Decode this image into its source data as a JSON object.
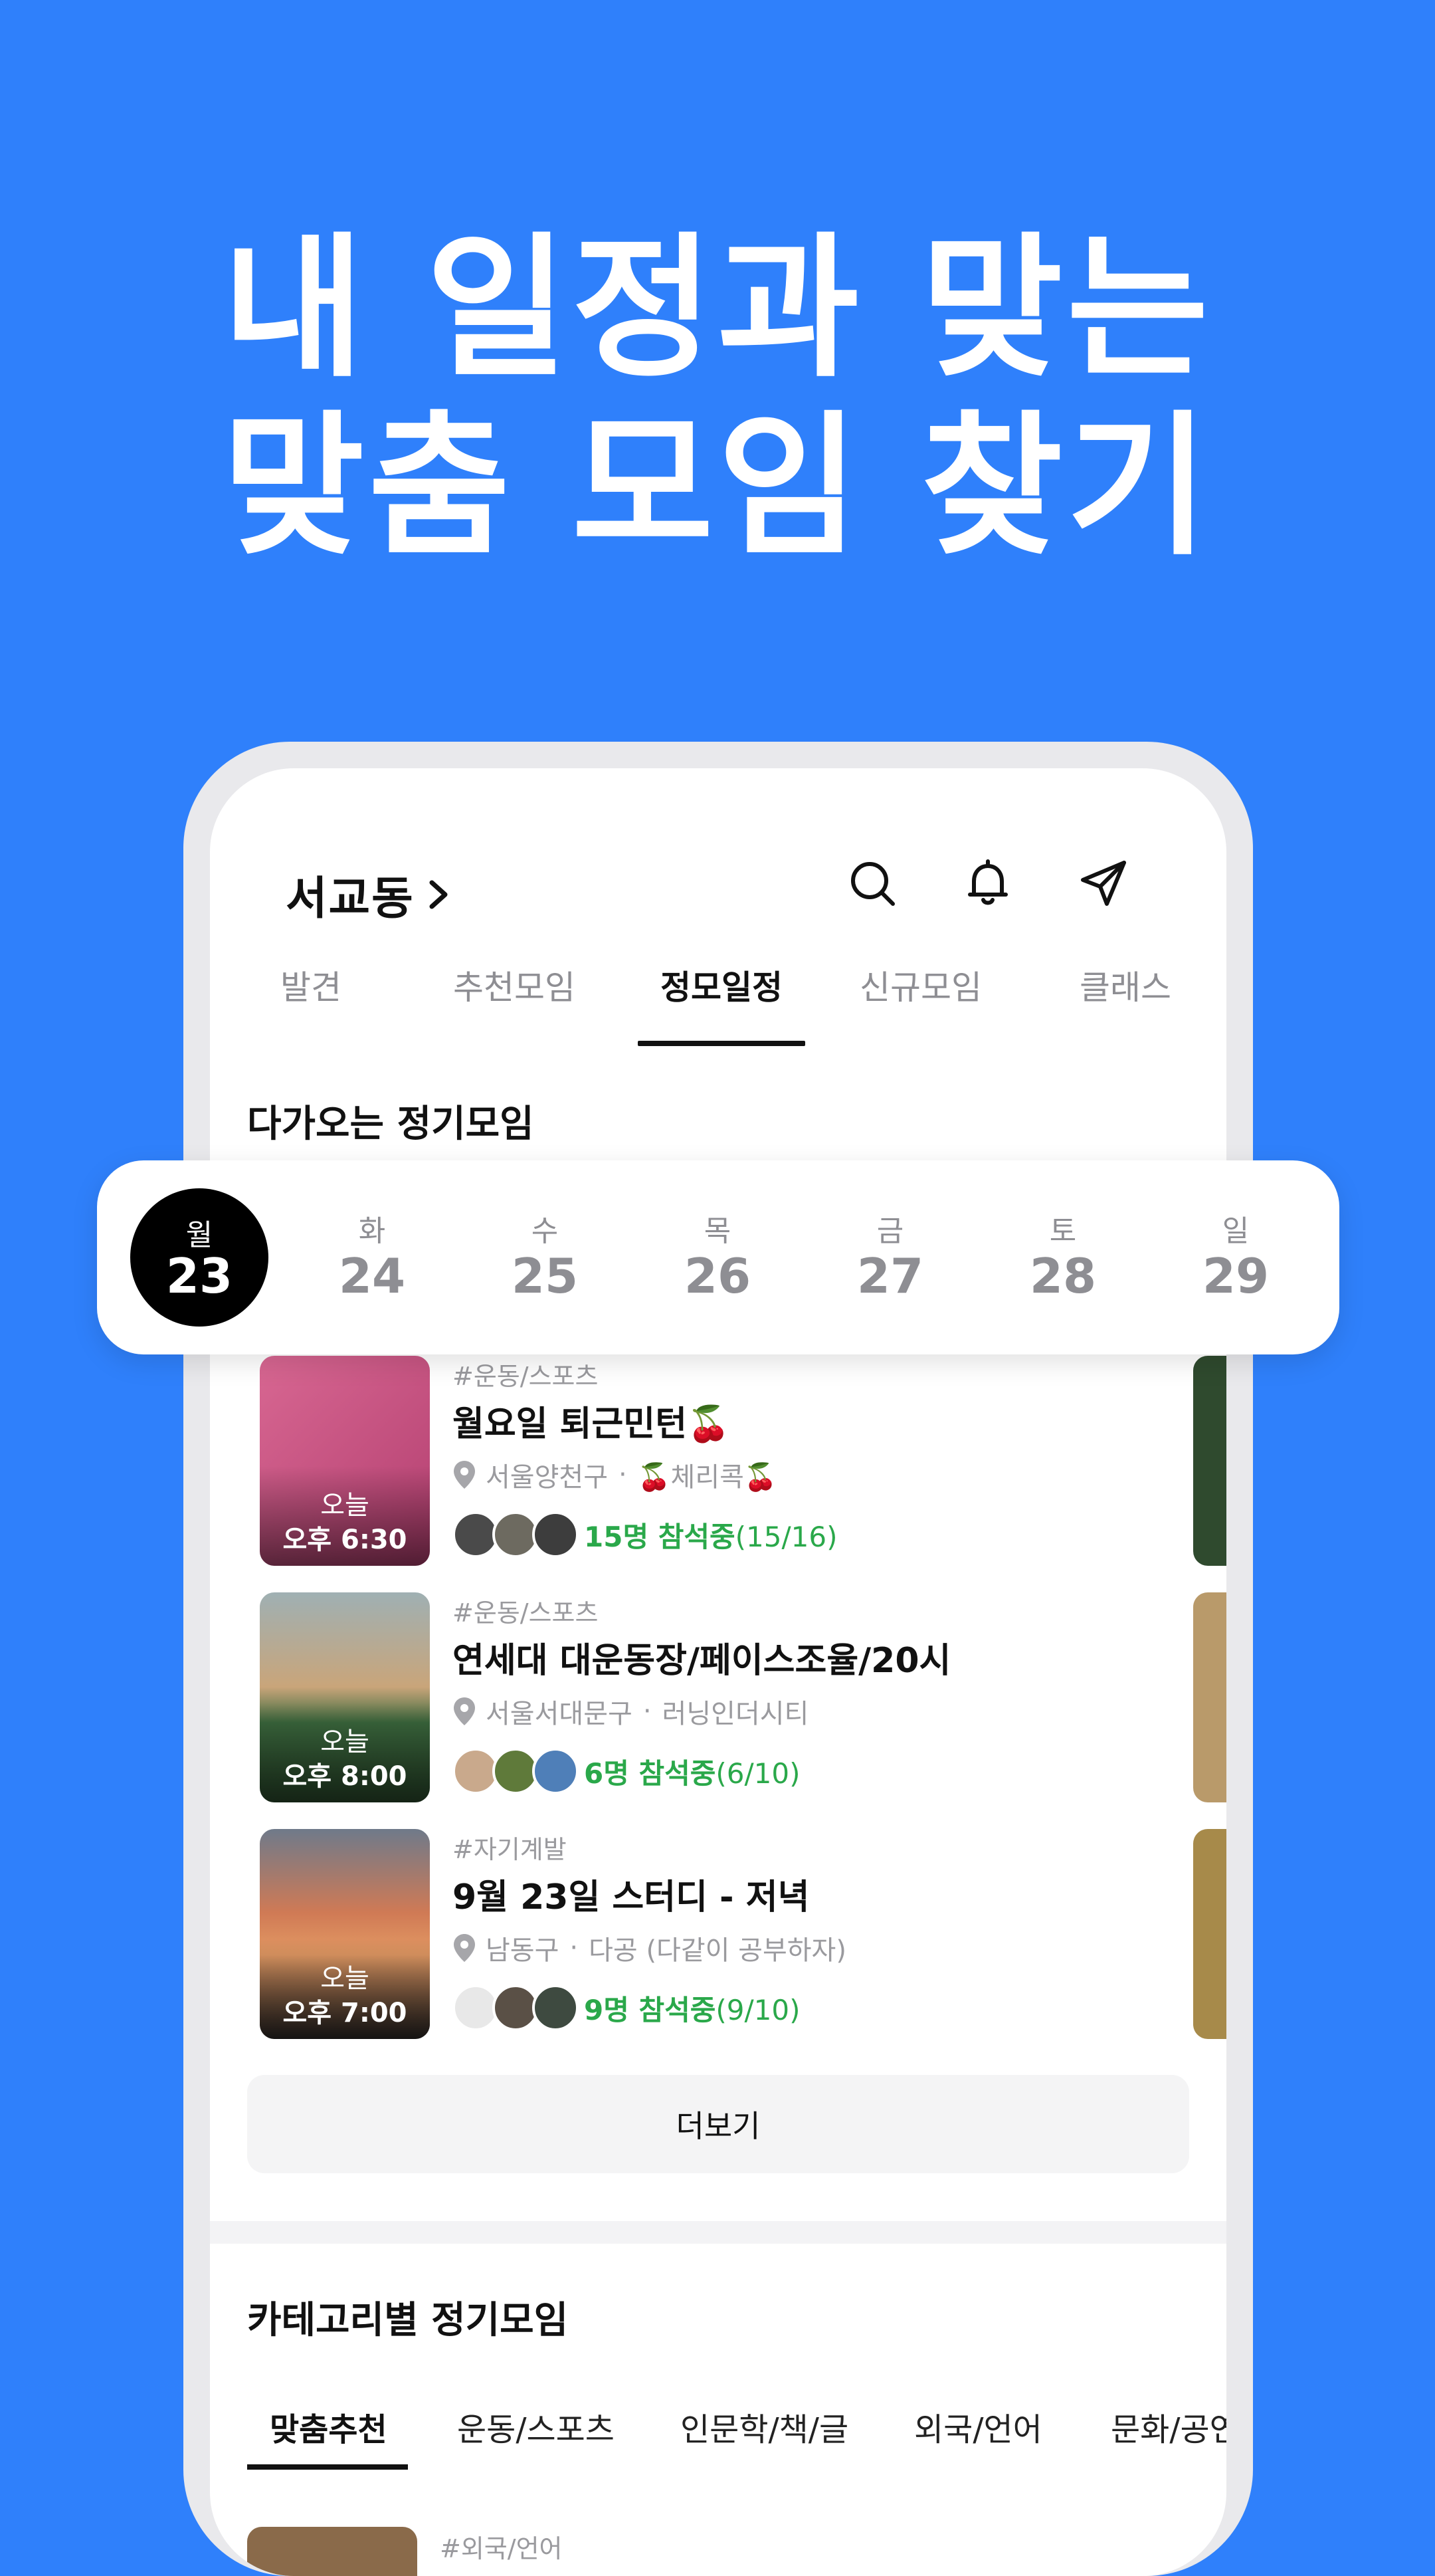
{
  "headline": {
    "line1": "내 일정과 맞는",
    "line2": "맞춤 모임 찾기"
  },
  "header": {
    "location": "서교동",
    "icons": [
      "search-icon",
      "bell-icon",
      "send-icon"
    ]
  },
  "tabs": [
    "발견",
    "추천모임",
    "정모일정",
    "신규모임",
    "클래스"
  ],
  "active_tab": "정모일정",
  "upcoming": {
    "title": "다가오는 정기모임"
  },
  "dates": [
    {
      "weekday": "월",
      "day": "23",
      "selected": true
    },
    {
      "weekday": "화",
      "day": "24"
    },
    {
      "weekday": "수",
      "day": "25"
    },
    {
      "weekday": "목",
      "day": "26"
    },
    {
      "weekday": "금",
      "day": "27"
    },
    {
      "weekday": "토",
      "day": "28"
    },
    {
      "weekday": "일",
      "day": "29"
    }
  ],
  "meetings": [
    {
      "category": "#운동/스포츠",
      "title": "월요일 퇴근민턴🍒",
      "district": "서울양천구",
      "group": "🍒체리콕🍒",
      "when_day": "오늘",
      "when_time": "오후 6:30",
      "count_label": "15명 참석중",
      "count_frac": "(15/16)",
      "thumb_color": "#c8517e"
    },
    {
      "category": "#운동/스포츠",
      "title": "연세대 대운동장/페이스조율/20시",
      "district": "서울서대문구",
      "group": "러닝인더시티",
      "when_day": "오늘",
      "when_time": "오후 8:00",
      "count_label": "6명 참석중",
      "count_frac": "(6/10)",
      "thumb_color": "#5b7a5a"
    },
    {
      "category": "#자기계발",
      "title": "9월 23일 스터디 - 저녁",
      "district": "남동구",
      "group": "다공 (다같이 공부하자)",
      "when_day": "오늘",
      "when_time": "오후 7:00",
      "count_label": "9명 참석중",
      "count_frac": "(9/10)",
      "thumb_color": "#c77c55"
    }
  ],
  "more_button": "더보기",
  "category_section": {
    "title": "카테고리별 정기모임",
    "tabs": [
      "맞춤추천",
      "운동/스포츠",
      "인문학/책/글",
      "외국/언어",
      "문화/공연"
    ],
    "active": "맞춤추천",
    "peek_category": "#외국/언어"
  }
}
